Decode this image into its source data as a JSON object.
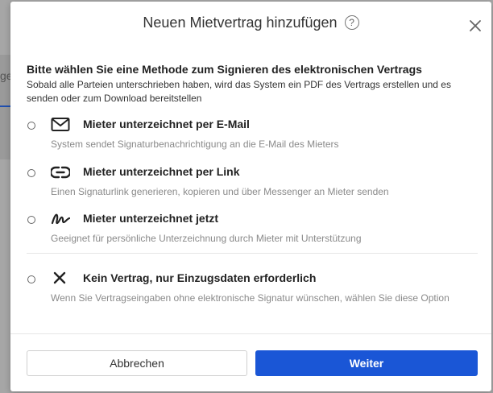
{
  "background": {
    "partial_text": "ge"
  },
  "dialog": {
    "title": "Neuen Mietvertrag hinzufügen",
    "help_glyph": "?",
    "close_icon": "close-icon"
  },
  "intro": {
    "heading": "Bitte wählen Sie eine Methode zum Signieren des elektronischen Vertrags",
    "description": "Sobald alle Parteien unterschrieben haben, wird das System ein PDF des Vertrags erstellen und es senden oder zum Download bereitstellen"
  },
  "options": [
    {
      "icon": "envelope-icon",
      "label": "Mieter unterzeichnet per E-Mail",
      "description": "System sendet Signaturbenachrichtigung an die E-Mail des Mieters"
    },
    {
      "icon": "link-icon",
      "label": "Mieter unterzeichnet per Link",
      "description": "Einen Signaturlink generieren, kopieren und über Messenger an Mieter senden"
    },
    {
      "icon": "signature-icon",
      "label": "Mieter unterzeichnet jetzt",
      "description": "Geeignet für persönliche Unterzeichnung durch Mieter mit Unterstützung"
    },
    {
      "icon": "x-mark-icon",
      "label": "Kein Vertrag, nur Einzugsdaten erforderlich",
      "description": "Wenn Sie Vertragseingaben ohne elektronische Signatur wünschen, wählen Sie diese Option"
    }
  ],
  "footer": {
    "cancel_label": "Abbrechen",
    "next_label": "Weiter"
  },
  "colors": {
    "primary": "#1a56d6",
    "overlay": "#a6a6a6"
  }
}
